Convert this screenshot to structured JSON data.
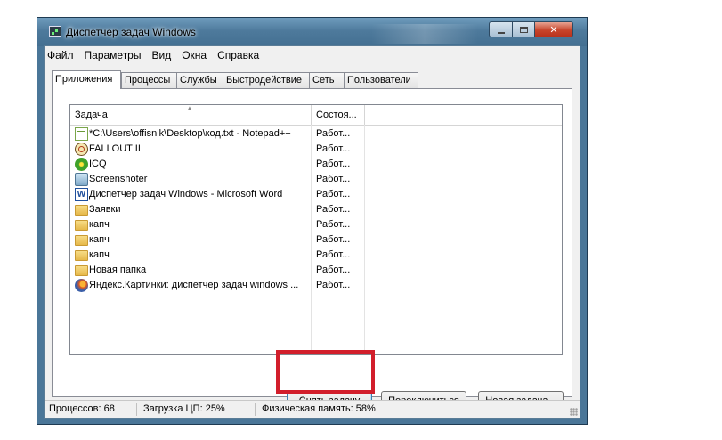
{
  "window": {
    "title": "Диспетчер задач Windows",
    "controls": {
      "minimize": "minimize",
      "maximize": "maximize",
      "close": "✕"
    }
  },
  "menu": [
    "Файл",
    "Параметры",
    "Вид",
    "Окна",
    "Справка"
  ],
  "tabs": [
    {
      "label": "Приложения",
      "active": true
    },
    {
      "label": "Процессы",
      "active": false
    },
    {
      "label": "Службы",
      "active": false
    },
    {
      "label": "Быстродействие",
      "active": false
    },
    {
      "label": "Сеть",
      "active": false
    },
    {
      "label": "Пользователи",
      "active": false
    }
  ],
  "list": {
    "columns": {
      "task": "Задача",
      "status": "Состоя..."
    },
    "sort_indicator": "▲",
    "rows": [
      {
        "icon": "notepad-icon",
        "name": "*C:\\Users\\offisnik\\Desktop\\код.txt - Notepad++",
        "status": "Работ..."
      },
      {
        "icon": "fallout-icon",
        "name": "FALLOUT II",
        "status": "Работ..."
      },
      {
        "icon": "icq-icon",
        "name": "ICQ",
        "status": "Работ..."
      },
      {
        "icon": "screenshoter-icon",
        "name": "Screenshoter",
        "status": "Работ..."
      },
      {
        "icon": "word-icon",
        "name": "Диспетчер задач Windows - Microsoft Word",
        "status": "Работ..."
      },
      {
        "icon": "folder-icon",
        "name": "Заявки",
        "status": "Работ..."
      },
      {
        "icon": "folder-icon",
        "name": "капч",
        "status": "Работ..."
      },
      {
        "icon": "folder-icon",
        "name": "капч",
        "status": "Работ..."
      },
      {
        "icon": "folder-icon",
        "name": "капч",
        "status": "Работ..."
      },
      {
        "icon": "folder-icon",
        "name": "Новая папка",
        "status": "Работ..."
      },
      {
        "icon": "firefox-icon",
        "name": "Яндекс.Картинки: диспетчер задач windows ...",
        "status": "Работ..."
      }
    ]
  },
  "buttons": {
    "end_task": "Снять задачу",
    "switch_to": "Переключиться",
    "new_task": "Новая задача..."
  },
  "status": {
    "processes": "Процессов: 68",
    "cpu": "Загрузка ЦП: 25%",
    "memory": "Физическая память: 58%"
  },
  "colors": {
    "highlight_box": "#d21e2b",
    "title_bar": "#4e7a9c"
  }
}
